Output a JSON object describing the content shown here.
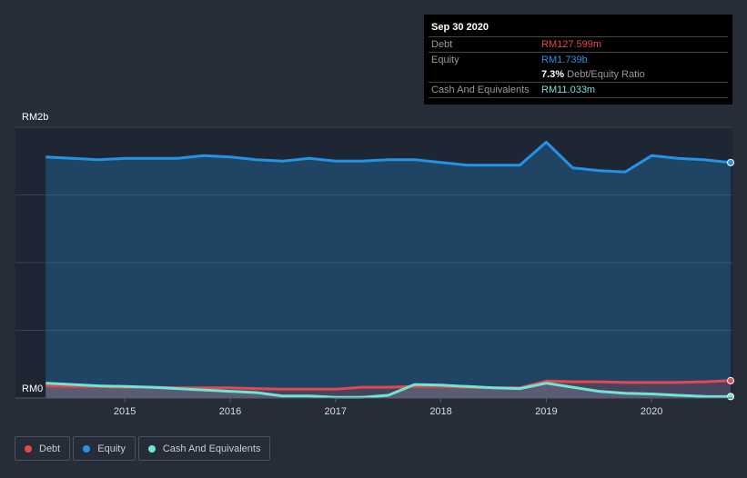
{
  "tooltip": {
    "date": "Sep 30 2020",
    "debt_label": "Debt",
    "debt_value": "RM127.599m",
    "equity_label": "Equity",
    "equity_value": "RM1.739b",
    "ratio_value": "7.3%",
    "ratio_label": "Debt/Equity Ratio",
    "cash_label": "Cash And Equivalents",
    "cash_value": "RM11.033m"
  },
  "legend": [
    {
      "label": "Debt",
      "color": "#e5474f"
    },
    {
      "label": "Equity",
      "color": "#2393e6"
    },
    {
      "label": "Cash And Equivalents",
      "color": "#6ee6d4"
    }
  ],
  "chart_data": {
    "type": "area",
    "y_tick_labels": [
      "RM2b",
      "RM0"
    ],
    "ylim": [
      0,
      2.0
    ],
    "y_unit": "RM billions",
    "xlim": [
      2014.23,
      2020.75
    ],
    "x_ticks": [
      2015,
      2016,
      2017,
      2018,
      2019,
      2020
    ],
    "x": [
      2014.25,
      2014.5,
      2014.75,
      2015.0,
      2015.25,
      2015.5,
      2015.75,
      2016.0,
      2016.25,
      2016.5,
      2016.75,
      2017.0,
      2017.25,
      2017.5,
      2017.75,
      2018.0,
      2018.25,
      2018.5,
      2018.75,
      2019.0,
      2019.25,
      2019.5,
      2019.75,
      2020.0,
      2020.25,
      2020.5,
      2020.75
    ],
    "series": [
      {
        "name": "Equity",
        "color": "#2393e6",
        "values": [
          1.78,
          1.77,
          1.76,
          1.77,
          1.77,
          1.77,
          1.79,
          1.78,
          1.76,
          1.75,
          1.77,
          1.75,
          1.75,
          1.76,
          1.76,
          1.74,
          1.72,
          1.72,
          1.72,
          1.89,
          1.7,
          1.68,
          1.67,
          1.79,
          1.77,
          1.76,
          1.739
        ]
      },
      {
        "name": "Debt",
        "color": "#e5474f",
        "values": [
          0.09,
          0.085,
          0.085,
          0.08,
          0.08,
          0.075,
          0.075,
          0.075,
          0.07,
          0.065,
          0.065,
          0.065,
          0.08,
          0.08,
          0.085,
          0.085,
          0.08,
          0.075,
          0.075,
          0.125,
          0.12,
          0.12,
          0.115,
          0.115,
          0.115,
          0.12,
          0.128
        ]
      },
      {
        "name": "Cash And Equivalents",
        "color": "#6ee6d4",
        "values": [
          0.11,
          0.1,
          0.09,
          0.085,
          0.08,
          0.07,
          0.06,
          0.05,
          0.04,
          0.015,
          0.015,
          0.005,
          0.005,
          0.02,
          0.1,
          0.095,
          0.085,
          0.075,
          0.07,
          0.11,
          0.08,
          0.05,
          0.035,
          0.03,
          0.02,
          0.012,
          0.011
        ]
      }
    ]
  }
}
